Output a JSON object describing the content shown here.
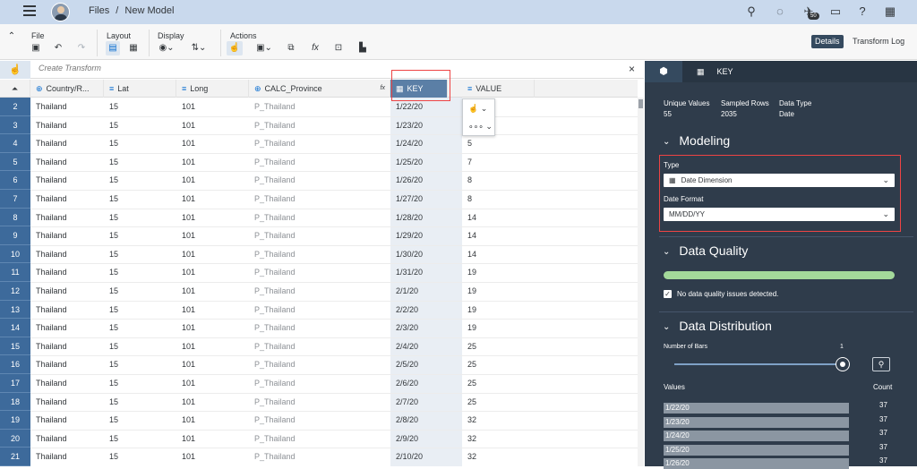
{
  "shell": {
    "breadcrumb": [
      "Files",
      "/",
      "New Model"
    ],
    "notification_count": "50"
  },
  "toolbar": {
    "groups": [
      "File",
      "Layout",
      "Display",
      "Actions"
    ],
    "details": "Details",
    "transform_log": "Transform Log"
  },
  "transform_bar": {
    "placeholder": "Create Transform",
    "close": "×"
  },
  "columns": [
    "Country/R...",
    "Lat",
    "Long",
    "CALC_Province",
    "KEY",
    "VALUE"
  ],
  "rows": [
    {
      "n": "2",
      "country": "Thailand",
      "lat": "15",
      "long": "101",
      "prov": "P_Thailand",
      "key": "1/22/20",
      "value": ""
    },
    {
      "n": "3",
      "country": "Thailand",
      "lat": "15",
      "long": "101",
      "prov": "P_Thailand",
      "key": "1/23/20",
      "value": ""
    },
    {
      "n": "4",
      "country": "Thailand",
      "lat": "15",
      "long": "101",
      "prov": "P_Thailand",
      "key": "1/24/20",
      "value": "5"
    },
    {
      "n": "5",
      "country": "Thailand",
      "lat": "15",
      "long": "101",
      "prov": "P_Thailand",
      "key": "1/25/20",
      "value": "7"
    },
    {
      "n": "6",
      "country": "Thailand",
      "lat": "15",
      "long": "101",
      "prov": "P_Thailand",
      "key": "1/26/20",
      "value": "8"
    },
    {
      "n": "7",
      "country": "Thailand",
      "lat": "15",
      "long": "101",
      "prov": "P_Thailand",
      "key": "1/27/20",
      "value": "8"
    },
    {
      "n": "8",
      "country": "Thailand",
      "lat": "15",
      "long": "101",
      "prov": "P_Thailand",
      "key": "1/28/20",
      "value": "14"
    },
    {
      "n": "9",
      "country": "Thailand",
      "lat": "15",
      "long": "101",
      "prov": "P_Thailand",
      "key": "1/29/20",
      "value": "14"
    },
    {
      "n": "10",
      "country": "Thailand",
      "lat": "15",
      "long": "101",
      "prov": "P_Thailand",
      "key": "1/30/20",
      "value": "14"
    },
    {
      "n": "11",
      "country": "Thailand",
      "lat": "15",
      "long": "101",
      "prov": "P_Thailand",
      "key": "1/31/20",
      "value": "19"
    },
    {
      "n": "12",
      "country": "Thailand",
      "lat": "15",
      "long": "101",
      "prov": "P_Thailand",
      "key": "2/1/20",
      "value": "19"
    },
    {
      "n": "13",
      "country": "Thailand",
      "lat": "15",
      "long": "101",
      "prov": "P_Thailand",
      "key": "2/2/20",
      "value": "19"
    },
    {
      "n": "14",
      "country": "Thailand",
      "lat": "15",
      "long": "101",
      "prov": "P_Thailand",
      "key": "2/3/20",
      "value": "19"
    },
    {
      "n": "15",
      "country": "Thailand",
      "lat": "15",
      "long": "101",
      "prov": "P_Thailand",
      "key": "2/4/20",
      "value": "25"
    },
    {
      "n": "16",
      "country": "Thailand",
      "lat": "15",
      "long": "101",
      "prov": "P_Thailand",
      "key": "2/5/20",
      "value": "25"
    },
    {
      "n": "17",
      "country": "Thailand",
      "lat": "15",
      "long": "101",
      "prov": "P_Thailand",
      "key": "2/6/20",
      "value": "25"
    },
    {
      "n": "18",
      "country": "Thailand",
      "lat": "15",
      "long": "101",
      "prov": "P_Thailand",
      "key": "2/7/20",
      "value": "25"
    },
    {
      "n": "19",
      "country": "Thailand",
      "lat": "15",
      "long": "101",
      "prov": "P_Thailand",
      "key": "2/8/20",
      "value": "32"
    },
    {
      "n": "20",
      "country": "Thailand",
      "lat": "15",
      "long": "101",
      "prov": "P_Thailand",
      "key": "2/9/20",
      "value": "32"
    },
    {
      "n": "21",
      "country": "Thailand",
      "lat": "15",
      "long": "101",
      "prov": "P_Thailand",
      "key": "2/10/20",
      "value": "32"
    }
  ],
  "panel": {
    "tab_label": "KEY",
    "unique_values_label": "Unique Values",
    "unique_values": "55",
    "sampled_rows_label": "Sampled Rows",
    "sampled_rows": "2035",
    "data_type_label": "Data Type",
    "data_type": "Date",
    "modeling": "Modeling",
    "type_label": "Type",
    "type_value": "Date Dimension",
    "format_label": "Date Format",
    "format_value": "MM/DD/YY",
    "quality": "Data Quality",
    "quality_fraction": 1.0,
    "quality_msg": "No data quality issues detected.",
    "distribution": "Data Distribution",
    "bars_label": "Number of Bars",
    "bars_value": "1",
    "values_label": "Values",
    "count_label": "Count",
    "dist": [
      {
        "v": "1/22/20",
        "c": "37"
      },
      {
        "v": "1/23/20",
        "c": "37"
      },
      {
        "v": "1/24/20",
        "c": "37"
      },
      {
        "v": "1/25/20",
        "c": "37"
      },
      {
        "v": "1/26/20",
        "c": "37"
      }
    ]
  }
}
